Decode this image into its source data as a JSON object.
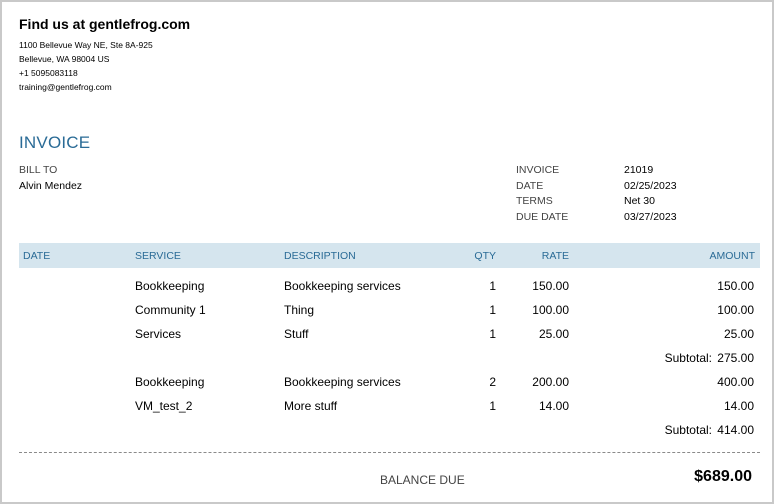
{
  "company": {
    "name": "Find us at gentlefrog.com",
    "address_line1": "1100 Bellevue Way NE, Ste 8A-925",
    "address_line2": "Bellevue, WA  98004 US",
    "phone": "+1 5095083118",
    "email": "training@gentlefrog.com"
  },
  "invoice": {
    "title": "INVOICE",
    "bill_to_label": "BILL TO",
    "bill_to_name": "Alvin Mendez",
    "meta": [
      {
        "label": "INVOICE",
        "value": "21019"
      },
      {
        "label": "DATE",
        "value": "02/25/2023"
      },
      {
        "label": "TERMS",
        "value": "Net 30"
      },
      {
        "label": "DUE DATE",
        "value": "03/27/2023"
      }
    ]
  },
  "table": {
    "headers": {
      "date": "DATE",
      "service": "SERVICE",
      "description": "DESCRIPTION",
      "qty": "QTY",
      "rate": "RATE",
      "amount": "AMOUNT"
    },
    "rows": [
      {
        "service": "Bookkeeping",
        "description": "Bookkeeping services",
        "qty": "1",
        "rate": "150.00",
        "amount": "150.00"
      },
      {
        "service": "Community 1",
        "description": "Thing",
        "qty": "1",
        "rate": "100.00",
        "amount": "100.00"
      },
      {
        "service": "Services",
        "description": "Stuff",
        "qty": "1",
        "rate": "25.00",
        "amount": "25.00"
      },
      {
        "subtotal_label": "Subtotal:",
        "subtotal": "275.00"
      },
      {
        "service": "Bookkeeping",
        "description": "Bookkeeping services",
        "qty": "2",
        "rate": "200.00",
        "amount": "400.00"
      },
      {
        "service": "VM_test_2",
        "description": "More stuff",
        "qty": "1",
        "rate": "14.00",
        "amount": "14.00"
      },
      {
        "subtotal_label": "Subtotal:",
        "subtotal": "414.00"
      }
    ]
  },
  "balance": {
    "label": "BALANCE DUE",
    "amount": "$689.00"
  },
  "colors": {
    "accent": "#2a6b96",
    "header_bg": "#d5e5ee"
  }
}
